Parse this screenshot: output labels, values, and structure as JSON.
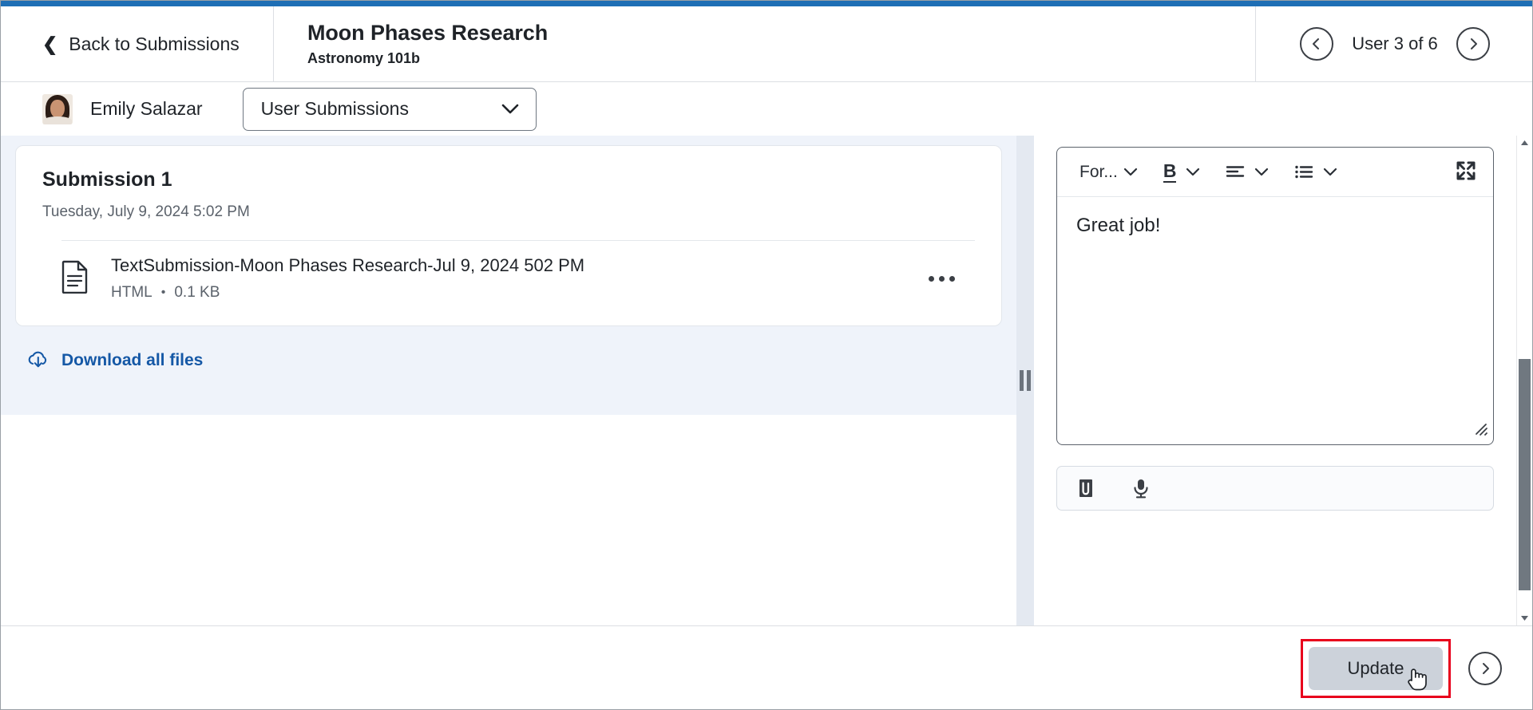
{
  "theme": {
    "accent_blue": "#1f6fb5",
    "link_blue": "#1558a6",
    "highlight_red": "#e8001c",
    "panel_bg": "#eff3fa",
    "button_gray": "#ccd2da"
  },
  "header": {
    "back_label": "Back to Submissions",
    "back_icon": "chevron-left-icon",
    "assignment_title": "Moon Phases Research",
    "course_name": "Astronomy 101b",
    "user_counter": "User 3 of 6",
    "prev_icon": "chevron-left-circle-icon",
    "next_icon": "chevron-right-circle-icon"
  },
  "user_bar": {
    "avatar_name": "avatar",
    "user_name": "Emily Salazar",
    "select_value": "User Submissions",
    "select_caret": "chevron-down-icon"
  },
  "submission": {
    "title": "Submission 1",
    "date": "Tuesday, July 9, 2024 5:02 PM",
    "file": {
      "icon": "document-icon",
      "name": "TextSubmission-Moon Phases Research-Jul 9, 2024 502 PM",
      "type": "HTML",
      "separator": "•",
      "size": "0.1 KB",
      "menu_icon": "more-options-icon"
    },
    "download_label": "Download all files",
    "download_icon": "cloud-download-icon"
  },
  "editor": {
    "toolbar": {
      "format_label": "For...",
      "format_caret": "chevron-down-icon",
      "bold_glyph": "B",
      "bold_caret": "chevron-down-icon",
      "align_icon": "align-left-icon",
      "align_caret": "chevron-down-icon",
      "list_icon": "bullet-list-icon",
      "list_caret": "chevron-down-icon",
      "expand_icon": "fullscreen-expand-icon"
    },
    "feedback_text": "Great job!",
    "resize_icon": "resize-grip-icon",
    "attach_icon": "paperclip-icon",
    "record_icon": "microphone-icon"
  },
  "footer": {
    "update_label": "Update",
    "cursor_icon": "pointer-hand-cursor",
    "next_icon": "chevron-right-circle-icon"
  },
  "scrollbar": {
    "up_icon": "triangle-up-icon",
    "down_icon": "triangle-down-icon",
    "thumb": "scrollbar-thumb"
  }
}
